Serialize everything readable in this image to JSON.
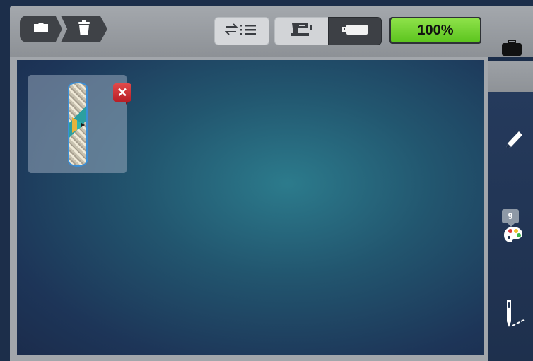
{
  "toolbar": {
    "breadcrumb": [
      {
        "icon": "folder-icon"
      },
      {
        "icon": "trash-icon"
      }
    ],
    "sort_icon": "sort-list-icon",
    "source_toggle": {
      "options": [
        {
          "icon": "sewing-machine-icon",
          "selected": true
        },
        {
          "icon": "usb-icon",
          "selected": false
        }
      ]
    },
    "zoom_label": "100%",
    "zoom_color": "#6fd231",
    "case_icon": "briefcase-icon"
  },
  "canvas": {
    "designs": [
      {
        "name": "embroidery-design-thumbnail",
        "delete_symbol": "✕"
      }
    ]
  },
  "side_panel": {
    "edit_icon": "pencil-icon",
    "color_palette": {
      "icon": "palette-icon",
      "count": "9"
    },
    "stitch_icon": "needle-stitch-icon"
  },
  "colors": {
    "toolbar": "#9a9ea3",
    "canvas_center": "#2c7b8c",
    "canvas_edge": "#1b2c4c",
    "delete": "#d0303a",
    "zoom": "#6fd231"
  }
}
